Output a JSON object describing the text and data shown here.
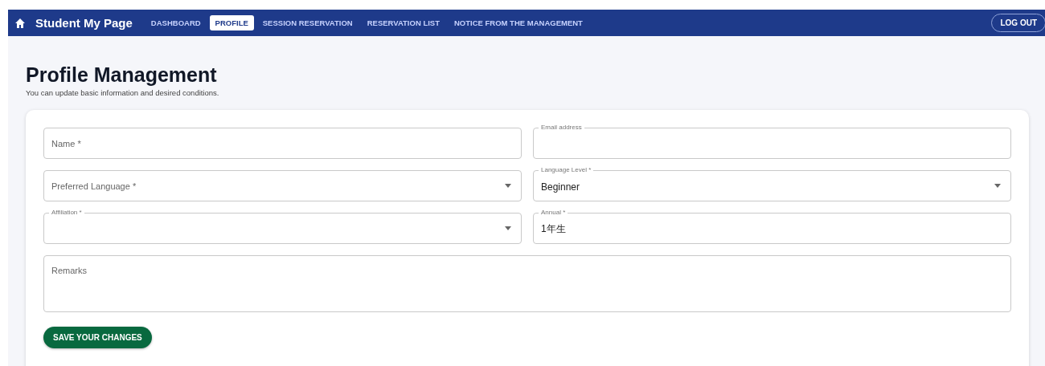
{
  "nav": {
    "title": "Student My Page",
    "tabs": [
      {
        "label": "DASHBOARD",
        "selected": false
      },
      {
        "label": "PROFILE",
        "selected": true
      },
      {
        "label": "SESSION RESERVATION",
        "selected": false
      },
      {
        "label": "RESERVATION LIST",
        "selected": false
      },
      {
        "label": "NOTICE FROM THE MANAGEMENT",
        "selected": false
      }
    ],
    "logout": "LOG OUT"
  },
  "heading": "Profile Management",
  "subtitle": "You can update basic information and desired conditions.",
  "form": {
    "rows": [
      [
        {
          "kind": "text",
          "label": "Name *",
          "floated": false
        },
        {
          "kind": "text",
          "label": "Email address",
          "floated": true
        }
      ],
      [
        {
          "kind": "select",
          "label": "Preferred Language *",
          "floated": false
        },
        {
          "kind": "select",
          "label": "Language Level *",
          "floated": true,
          "value": "Beginner"
        }
      ],
      [
        {
          "kind": "select",
          "label": "Affiliation *",
          "floated": true
        },
        {
          "kind": "text",
          "label": "Annual *",
          "floated": true,
          "value": "1年生"
        }
      ],
      [
        {
          "kind": "textarea",
          "label": "Remarks",
          "floated": false
        }
      ]
    ],
    "save": "SAVE YOUR CHANGES"
  }
}
